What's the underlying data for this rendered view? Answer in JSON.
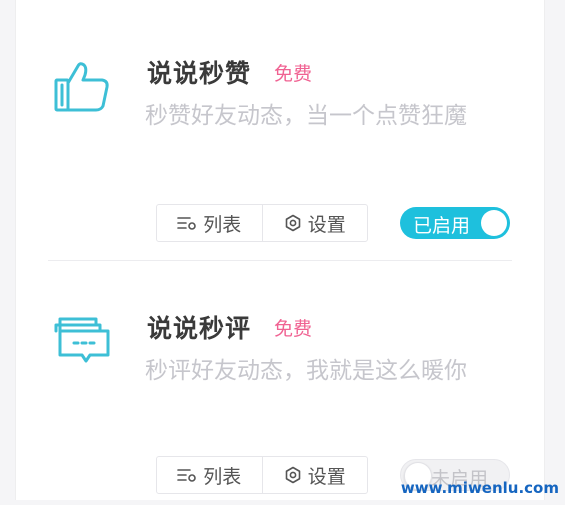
{
  "accent_color": "#1ec0dd",
  "badge_color": "#f06292",
  "features": [
    {
      "icon": "thumbs-up-icon",
      "title": "说说秒赞",
      "badge": "免费",
      "description": "秒赞好友动态，当一个点赞狂魔",
      "list_label": "列表",
      "settings_label": "设置",
      "toggle_label": "已启用",
      "enabled": true
    },
    {
      "icon": "comment-bubbles-icon",
      "title": "说说秒评",
      "badge": "免费",
      "description": "秒评好友动态，我就是这么暖你",
      "list_label": "列表",
      "settings_label": "设置",
      "toggle_label": "未启用",
      "enabled": false
    }
  ],
  "watermark": "www.miwenlu.com"
}
